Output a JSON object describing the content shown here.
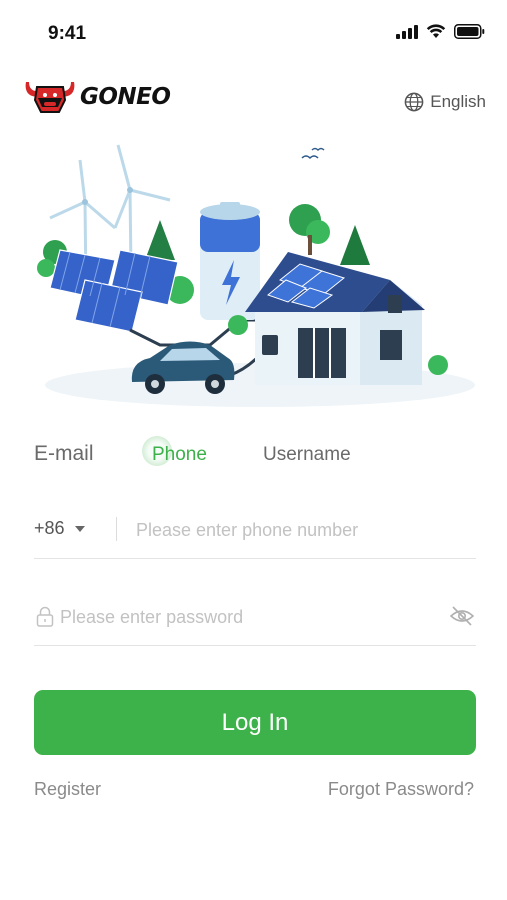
{
  "status_bar": {
    "time": "9:41",
    "icons": [
      "signal-icon",
      "wifi-icon",
      "battery-icon"
    ]
  },
  "header": {
    "brand": "GONEO",
    "language": "English",
    "icons": [
      "bull-logo-icon",
      "globe-icon"
    ]
  },
  "login": {
    "tabs": [
      {
        "label": "E-mail",
        "active": false
      },
      {
        "label": "Phone",
        "active": true
      },
      {
        "label": "Username",
        "active": false
      }
    ],
    "phone": {
      "country_code": "+86",
      "placeholder": "Please enter phone number",
      "value": ""
    },
    "password": {
      "placeholder": "Please enter password",
      "value": ""
    },
    "login_button": "Log In",
    "register_link": "Register",
    "forgot_link": "Forgot Password?"
  },
  "colors": {
    "accent": "#3eb24a",
    "text_muted": "#8a8a8a",
    "placeholder": "#c2c2c2",
    "brand_red": "#d62828"
  }
}
